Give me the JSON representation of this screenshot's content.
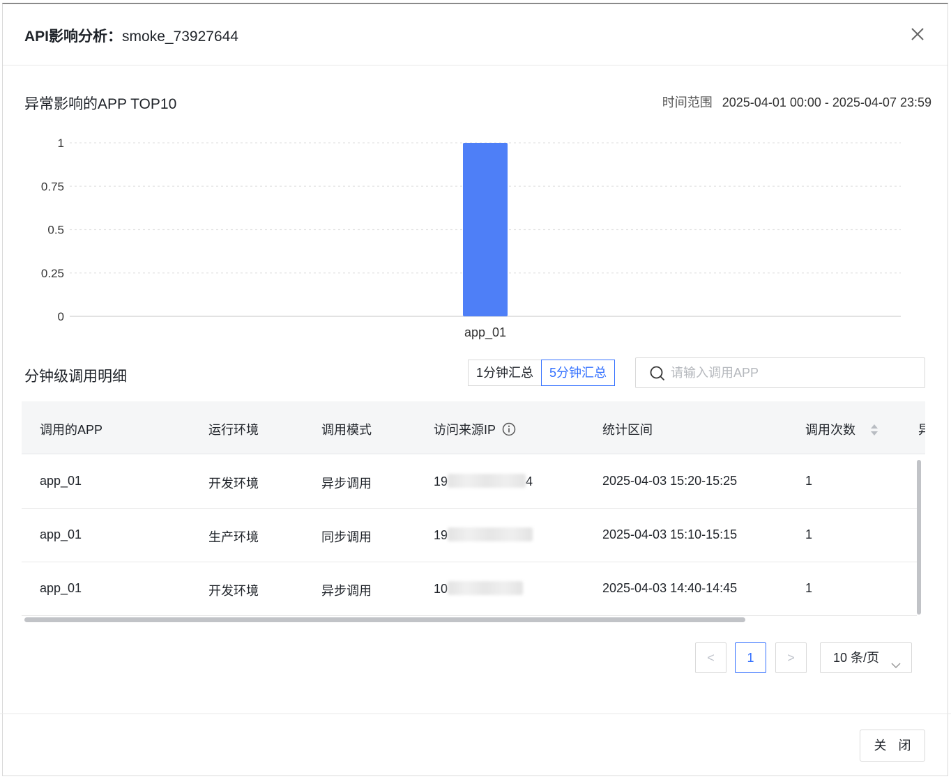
{
  "dialog": {
    "title_prefix": "API影响分析：",
    "title_name": "smoke_73927644",
    "close_button": "关 闭"
  },
  "chart_section": {
    "title": "异常影响的APP TOP10",
    "range_label": "时间范围",
    "range_value": "2025-04-01 00:00 - 2025-04-07 23:59"
  },
  "chart_data": {
    "type": "bar",
    "categories": [
      "app_01"
    ],
    "values": [
      1
    ],
    "title": "",
    "xlabel": "",
    "ylabel": "",
    "ylim": [
      0,
      1
    ],
    "yticks": [
      "0",
      "0.25",
      "0.5",
      "0.75",
      "1"
    ],
    "bar_color": "#4e7ff7",
    "grid": true
  },
  "detail_section": {
    "title": "分钟级调用明细",
    "toggle_options": [
      "1分钟汇总",
      "5分钟汇总"
    ],
    "active_option": "5分钟汇总",
    "search_placeholder": "请输入调用APP"
  },
  "table": {
    "headers": [
      "调用的APP",
      "运行环境",
      "调用模式",
      "访问来源IP",
      "统计区间",
      "调用次数",
      "异"
    ],
    "rows": [
      {
        "app": "app_01",
        "env": "开发环境",
        "mode": "异步调用",
        "ip_start": "19",
        "ip_end": "4",
        "interval": "2025-04-03 15:20-15:25",
        "count": "1"
      },
      {
        "app": "app_01",
        "env": "生产环境",
        "mode": "同步调用",
        "ip_start": "19",
        "ip_end": "",
        "interval": "2025-04-03 15:10-15:15",
        "count": "1"
      },
      {
        "app": "app_01",
        "env": "开发环境",
        "mode": "异步调用",
        "ip_start": "10",
        "ip_end": "",
        "interval": "2025-04-03 14:40-14:45",
        "count": "1"
      }
    ]
  },
  "pagination": {
    "prev": "<",
    "current_page": "1",
    "next": ">",
    "page_size": "10 条/页"
  },
  "colors": {
    "accent": "#3370ff",
    "bar": "#4e7ff7"
  }
}
